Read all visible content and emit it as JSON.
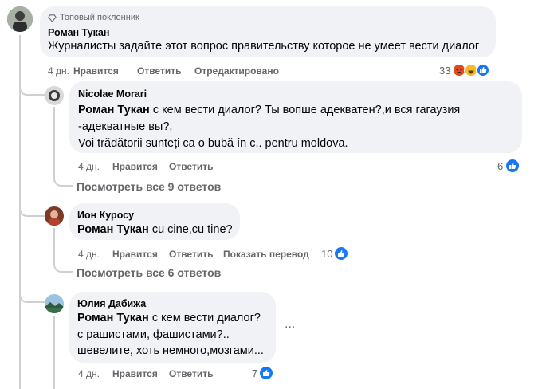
{
  "main_comment": {
    "badge": "Топовый поклонник",
    "author": "Роман Тукан",
    "text": "Журналисты задайте этот вопрос правительству которое не умеет вести диалог",
    "time": "4 дн.",
    "like_label": "Нравится",
    "reply_label": "Ответить",
    "edited_label": "Отредактировано",
    "reactions_count": "33",
    "reactions": [
      "angry-icon",
      "haha-icon",
      "like-icon"
    ]
  },
  "replies": [
    {
      "author": "Nicolae Morari",
      "mention": "Роман Тукан",
      "text_line1": " с кем вести диалог? Ты вопше адекватен?,и вся гагаузия",
      "text_line2": "-адекватные вы?,",
      "text_line3": "Voi trădătorii sunteți ca o bubă în c.. pentru moldova.",
      "time": "4 дн.",
      "like_label": "Нравится",
      "reply_label": "Ответить",
      "reactions_count": "6",
      "view_more": "Посмотреть все 9 ответов",
      "avatar_color": "#6b6f74"
    },
    {
      "author": "Ион Куросу",
      "mention": "Роман Тукан",
      "text_line1": " cu cine,cu tine?",
      "time": "4 дн.",
      "like_label": "Нравится",
      "reply_label": "Ответить",
      "translate_label": "Показать перевод",
      "reactions_count": "10",
      "view_more": "Посмотреть все 6 ответов",
      "avatar_color": "#8a4a2e"
    },
    {
      "author": "Юлия Дабижа",
      "mention": "Роман Тукан",
      "text_line1": " с кем вести диалог?",
      "text_line2": "с рашистами, фашистами?..",
      "text_line3": "шевелите, хоть немного,мозгами...",
      "time": "4 дн.",
      "like_label": "Нравится",
      "reply_label": "Ответить",
      "reactions_count": "7",
      "more_menu": "...",
      "avatar_color": "#3f6e8c"
    }
  ]
}
